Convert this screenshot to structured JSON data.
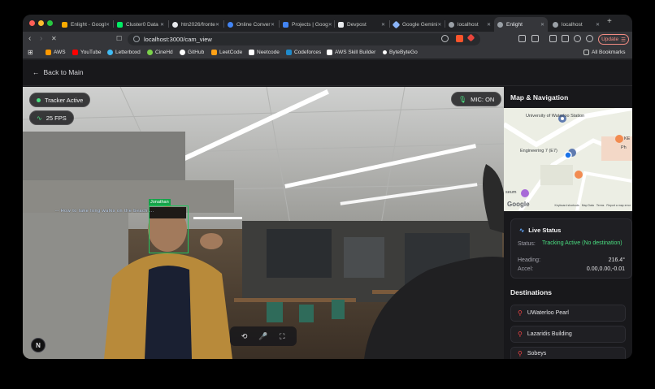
{
  "browser": {
    "tabs": [
      {
        "label": "Enlight - Googl",
        "color": "#f9ab00"
      },
      {
        "label": "Cluster0 Data",
        "color": "#00ed64"
      },
      {
        "label": "htn2026/fronte",
        "color": "#ffffff"
      },
      {
        "label": "Online Conver",
        "color": "#4285f4"
      },
      {
        "label": "Projects | Goog",
        "color": "#4285f4"
      },
      {
        "label": "Devpost",
        "color": "#ffffff"
      },
      {
        "label": "Google Gemini",
        "color": "#8ab4f8"
      },
      {
        "label": "localhost",
        "color": "#9aa0a6"
      },
      {
        "label": "Enlight",
        "color": "#9aa0a6"
      },
      {
        "label": "localhost",
        "color": "#9aa0a6"
      }
    ],
    "url": "localhost:3000/cam_view",
    "update_label": "Update",
    "bookmarks": [
      {
        "label": "AWS",
        "color": "#ff9900"
      },
      {
        "label": "YouTube",
        "color": "#ff0000"
      },
      {
        "label": "Letterboxd",
        "color": "#40bcf4"
      },
      {
        "label": "CineHd",
        "color": "#7bd24a"
      },
      {
        "label": "GitHub",
        "color": "#ffffff"
      },
      {
        "label": "LeetCode",
        "color": "#ffa116"
      },
      {
        "label": "Neetcode",
        "color": "#ffffff"
      },
      {
        "label": "Codeforces",
        "color": "#1f8acb"
      },
      {
        "label": "AWS Skill Builder",
        "color": "#232f3e"
      },
      {
        "label": "ByteByteGo",
        "color": "#ffffff"
      }
    ],
    "all_bookmarks_label": "All Bookmarks"
  },
  "header": {
    "back_label": "Back to Main"
  },
  "camera": {
    "tracker_label": "Tracker Active",
    "fps_label": "25 FPS",
    "mic_label": "MIC: ON",
    "face_label": "Jonathan",
    "overlay_text": "-- How to take long walks on the beach ..."
  },
  "sidebar": {
    "title": "Map & Navigation",
    "map": {
      "labels": [
        "University of Waterloo Station",
        "Engineering 7 (E7)",
        "KE",
        "Ph",
        "seum"
      ],
      "logo": "Google",
      "footer": [
        "Keyboard shortcuts",
        "Map Data",
        "Terms",
        "Report a map error"
      ]
    },
    "live_status": {
      "title": "Live Status",
      "status_label": "Status:",
      "status_value": "Tracking Active (No destination)",
      "heading_label": "Heading:",
      "heading_value": "216.4°",
      "accel_label": "Accel:",
      "accel_value": "0.00,0.00,-0.01"
    },
    "destinations_title": "Destinations",
    "destinations": [
      "UWaterloo Pearl",
      "Lazaridis Building",
      "Sobeys"
    ]
  }
}
